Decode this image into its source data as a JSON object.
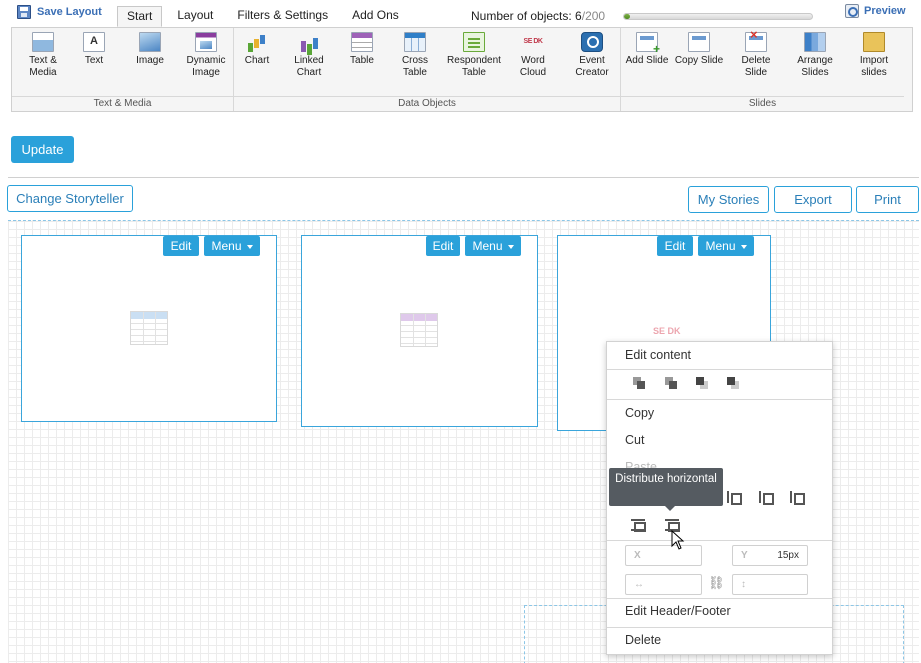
{
  "header": {
    "save_layout": "Save Layout",
    "tabs": [
      "Start",
      "Layout",
      "Filters & Settings",
      "Add Ons"
    ],
    "active_tab": "Start",
    "objects_label": "Number of objects: ",
    "objects_current": "6",
    "objects_max": "/200",
    "objects_progress": 0.03,
    "preview": "Preview"
  },
  "ribbon": {
    "groups": {
      "text_media": "Text & Media",
      "data_objects": "Data Objects",
      "slides": "Slides"
    },
    "text_media": [
      {
        "label": "Text &\nMedia",
        "icon": "text-media-icon"
      },
      {
        "label": "Text",
        "icon": "text-icon"
      },
      {
        "label": "Image",
        "icon": "image-icon"
      },
      {
        "label": "Dynamic\nImage",
        "icon": "dynamic-image-icon"
      }
    ],
    "data_objects": [
      {
        "label": "Chart",
        "icon": "chart-icon"
      },
      {
        "label": "Linked\nChart",
        "icon": "linked-chart-icon"
      },
      {
        "label": "Table",
        "icon": "table-icon"
      },
      {
        "label": "Cross\nTable",
        "icon": "cross-table-icon"
      },
      {
        "label": "Respondent\nTable",
        "icon": "respondent-table-icon"
      },
      {
        "label": "Word\nCloud",
        "icon": "word-cloud-icon"
      },
      {
        "label": "Event\nCreator",
        "icon": "event-creator-icon"
      }
    ],
    "slides": [
      {
        "label": "Add Slide",
        "icon": "add-slide-icon"
      },
      {
        "label": "Copy Slide",
        "icon": "copy-slide-icon"
      },
      {
        "label": "Delete\nSlide",
        "icon": "delete-slide-icon"
      },
      {
        "label": "Arrange\nSlides",
        "icon": "arrange-slides-icon"
      },
      {
        "label": "Import\nslides",
        "icon": "import-slides-icon"
      }
    ]
  },
  "toolbar": {
    "update": "Update",
    "change_storyteller": "Change Storyteller",
    "my_stories": "My Stories",
    "export": "Export",
    "print": "Print"
  },
  "widgets": {
    "edit": "Edit",
    "menu": "Menu",
    "cloud_text": "SE DK"
  },
  "context_menu": {
    "edit_content": "Edit content",
    "copy": "Copy",
    "cut": "Cut",
    "paste": "Paste",
    "x_label": "X",
    "y_label": "Y",
    "y_value": "15px",
    "w_label": "↔",
    "h_label": "↕",
    "edit_header_footer": "Edit Header/Footer",
    "delete": "Delete",
    "tooltip": "Distribute horizontal"
  },
  "colors": {
    "accent": "#2aa1da",
    "link": "#3b6fb5",
    "progress": "#4d8a1e"
  }
}
